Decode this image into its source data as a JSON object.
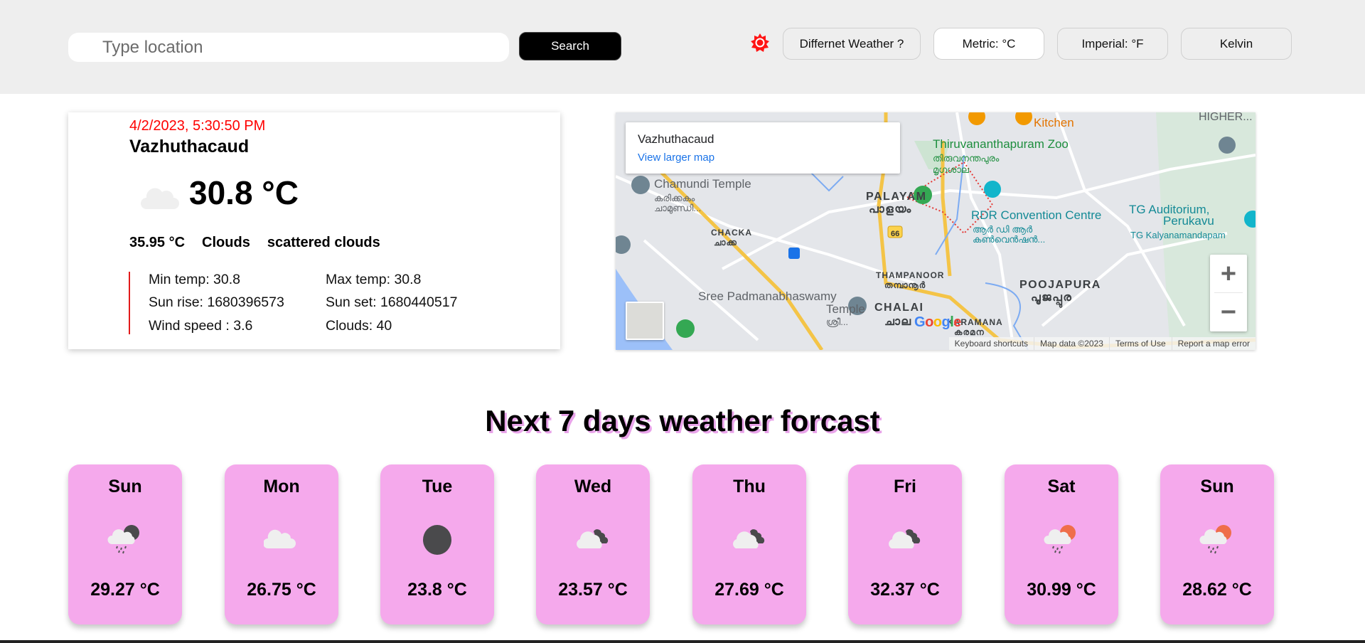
{
  "header": {
    "search_placeholder": "Type location",
    "search_value": "",
    "search_label": "Search",
    "theme_icon": "sun-icon",
    "accent_color": "#ff0000",
    "unit_buttons": [
      {
        "label": "Differnet Weather ?",
        "active": false
      },
      {
        "label": "Metric: °C",
        "active": true
      },
      {
        "label": "Imperial: °F",
        "active": false
      },
      {
        "label": "Kelvin",
        "active": false
      }
    ]
  },
  "current": {
    "datetime": "4/2/2023, 5:30:50 PM",
    "city": "Vazhuthacaud",
    "icon": "cloud-icon",
    "temperature": "30.8 °C",
    "feels_like": "35.95 °C",
    "condition": "Clouds",
    "description": "scattered clouds",
    "details": {
      "min_temp": "Min temp: 30.8",
      "max_temp": "Max temp: 30.8",
      "sunrise": "Sun rise: 1680396573",
      "sunset": "Sun set: 1680440517",
      "wind_speed": "Wind speed : 3.6",
      "clouds": "Clouds: 40"
    }
  },
  "map": {
    "place_name": "Vazhuthacaud",
    "view_larger_label": "View larger map",
    "labels": {
      "zoo": "Thiruvananthapuram Zoo",
      "zoo_ml": "തിരുവനന്തപുരം",
      "zoo_ml2": "മൃഗശാല",
      "kitchen": "Kitchen",
      "chamundi": "Chamundi Temple",
      "chamundi_ml": "കരിക്കകം",
      "chamundi_ml2": "ചാമുണ്ഡി...",
      "palayam": "PALAYAM",
      "palayam_ml": "പാളയം",
      "rdr": "RDR Convention Centre",
      "rdr_ml": "ആർ ഡി ആർ",
      "rdr_ml2": "കൺവെൻഷൻ...",
      "tg": "TG Auditorium,",
      "tg2": "Perukavu",
      "tg3": "TG Kalyanamandapam",
      "higher": "HIGHER...",
      "chacka": "CHACKA",
      "chacka_ml": "ചാക്ക",
      "route": "66",
      "thampanoor": "THAMPANOOR",
      "thampanoor_ml": "തമ്പാനൂർ",
      "poojapura": "POOJAPURA",
      "poojapura_ml": "പൂജപ്പുര",
      "padmanabha": "Sree Padmanabhaswamy",
      "padmanabha2": "Temple",
      "padmanabha_ml": "ശ്രീ...",
      "chalai": "CHALAI",
      "chalai_ml": "ചാല",
      "karamana": "KARAMANA",
      "karamana_ml": "കരമന"
    },
    "google_logo": "Google",
    "zoom_in": "+",
    "zoom_out": "−",
    "footer": [
      "Keyboard shortcuts",
      "Map data ©2023",
      "Terms of Use",
      "Report a map error"
    ]
  },
  "forecast": {
    "title": "Next 7 days weather forcast",
    "card_color": "#f5a9ec",
    "days": [
      {
        "day": "Sun",
        "temp": "29.27 °C",
        "icon": "rain-night-icon"
      },
      {
        "day": "Mon",
        "temp": "26.75 °C",
        "icon": "cloud-icon"
      },
      {
        "day": "Tue",
        "temp": "23.8 °C",
        "icon": "moon-icon"
      },
      {
        "day": "Wed",
        "temp": "23.57 °C",
        "icon": "cloudy-night-icon"
      },
      {
        "day": "Thu",
        "temp": "27.69 °C",
        "icon": "cloudy-night-icon"
      },
      {
        "day": "Fri",
        "temp": "32.37 °C",
        "icon": "cloudy-night-icon"
      },
      {
        "day": "Sat",
        "temp": "30.99 °C",
        "icon": "rain-sun-icon"
      },
      {
        "day": "Sun",
        "temp": "28.62 °C",
        "icon": "rain-sun-icon"
      }
    ]
  }
}
